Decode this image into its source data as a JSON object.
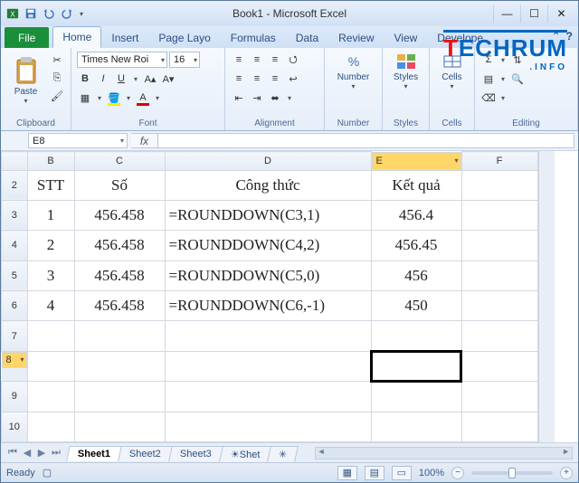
{
  "title": "Book1 - Microsoft Excel",
  "tabs": {
    "file": "File",
    "home": "Home",
    "insert": "Insert",
    "pagelayout": "Page Layo",
    "formulas": "Formulas",
    "data": "Data",
    "review": "Review",
    "view": "View",
    "developer": "Develope"
  },
  "ribbon": {
    "clipboard": {
      "paste": "Paste",
      "label": "Clipboard"
    },
    "font": {
      "name": "Times New Roi",
      "size": "16",
      "bold": "B",
      "italic": "I",
      "underline": "U",
      "label": "Font"
    },
    "alignment": {
      "label": "Alignment"
    },
    "number": {
      "label": "Number",
      "btn": "Number",
      "percent": "%"
    },
    "styles": {
      "label": "Styles",
      "btn": "Styles"
    },
    "cells": {
      "label": "Cells",
      "btn": "Cells"
    },
    "editing": {
      "label": "Editing"
    }
  },
  "namebox": "E8",
  "fx": "fx",
  "columns": {
    "b": "B",
    "c": "C",
    "d": "D",
    "e": "E",
    "f": "F"
  },
  "rows": {
    "r2": "2",
    "r3": "3",
    "r4": "4",
    "r5": "5",
    "r6": "6",
    "r7": "7",
    "r8": "8",
    "r9": "9",
    "r10": "10"
  },
  "cells": {
    "header": {
      "b": "STT",
      "c": "Số",
      "d": "Công thức",
      "e": "Kết quả"
    },
    "r3": {
      "b": "1",
      "c": "456.458",
      "d": "=ROUNDDOWN(C3,1)",
      "e": "456.4"
    },
    "r4": {
      "b": "2",
      "c": "456.458",
      "d": "=ROUNDDOWN(C4,2)",
      "e": "456.45"
    },
    "r5": {
      "b": "3",
      "c": "456.458",
      "d": "=ROUNDDOWN(C5,0)",
      "e": "456"
    },
    "r6": {
      "b": "4",
      "c": "456.458",
      "d": "=ROUNDDOWN(C6,-1)",
      "e": "450"
    }
  },
  "sheets": {
    "s1": "Sheet1",
    "s2": "Sheet2",
    "s3": "Sheet3",
    "s4": "Shet"
  },
  "status": {
    "ready": "Ready",
    "zoom": "100%"
  },
  "logo": {
    "t": "T",
    "rest": "ECHRUM",
    "sub": ".INFO"
  }
}
